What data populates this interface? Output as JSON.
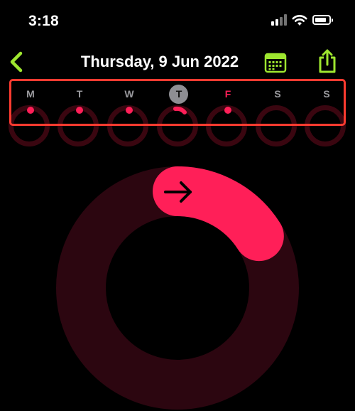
{
  "status_bar": {
    "time": "3:18"
  },
  "nav": {
    "title": "Thursday, 9 Jun 2022"
  },
  "week": {
    "days": [
      {
        "label": "M",
        "activity": "dot"
      },
      {
        "label": "T",
        "activity": "dot"
      },
      {
        "label": "W",
        "activity": "dot"
      },
      {
        "label": "T",
        "activity": "arc",
        "state": "today"
      },
      {
        "label": "F",
        "activity": "dot",
        "state": "highlighted"
      },
      {
        "label": "S",
        "activity": "none"
      },
      {
        "label": "S",
        "activity": "none"
      }
    ]
  },
  "move_ring": {
    "progress": 0.16
  },
  "colors": {
    "accent": "#9ee62f",
    "move": "#ff1f58",
    "move_track": "#2c0610",
    "selection_border": "#ff3b30",
    "today_circle": "#8e8e93"
  },
  "icons": {
    "back": "chevron-left-icon",
    "calendar": "calendar-icon",
    "share": "share-icon",
    "ring_arrow": "arrow-right-icon"
  }
}
